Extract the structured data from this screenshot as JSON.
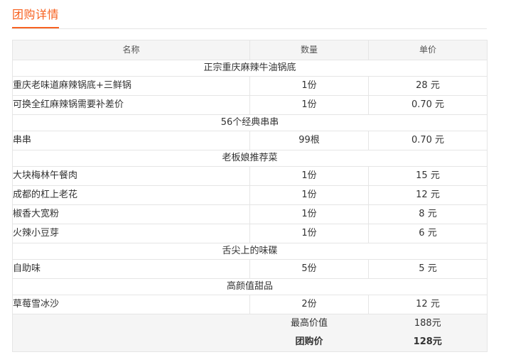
{
  "section": {
    "title": "团购详情"
  },
  "table": {
    "headers": {
      "name": "名称",
      "qty": "数量",
      "price": "单价"
    },
    "groups": [
      {
        "title": "正宗重庆麻辣牛油锅底",
        "rows": [
          {
            "name": "重庆老味道麻辣锅底+三鲜锅",
            "qty": "1份",
            "price": "28 元"
          },
          {
            "name": "可换全红麻辣锅需要补差价",
            "qty": "1份",
            "price": "0.70 元"
          }
        ]
      },
      {
        "title": "56个经典串串",
        "rows": [
          {
            "name": "串串",
            "qty": "99根",
            "price": "0.70 元"
          }
        ]
      },
      {
        "title": "老板娘推荐菜",
        "rows": [
          {
            "name": "大块梅林午餐肉",
            "qty": "1份",
            "price": "15 元"
          },
          {
            "name": "成都的杠上老花",
            "qty": "1份",
            "price": "12 元"
          },
          {
            "name": "椒香大宽粉",
            "qty": "1份",
            "price": "8 元"
          },
          {
            "name": "火辣小豆芽",
            "qty": "1份",
            "price": "6 元"
          }
        ]
      },
      {
        "title": "舌尖上的味碟",
        "rows": [
          {
            "name": "自助味",
            "qty": "5份",
            "price": "5 元"
          }
        ]
      },
      {
        "title": "高颜值甜品",
        "rows": [
          {
            "name": "草莓雪冰沙",
            "qty": "2份",
            "price": "12 元"
          }
        ]
      }
    ],
    "summary": {
      "original_label": "最高价值",
      "original_value": "188元",
      "deal_label": "团购价",
      "deal_value": "128元"
    }
  },
  "colors": {
    "accent": "#f76120",
    "border": "#e5e5e5",
    "header_bg": "#f5f5f5"
  }
}
